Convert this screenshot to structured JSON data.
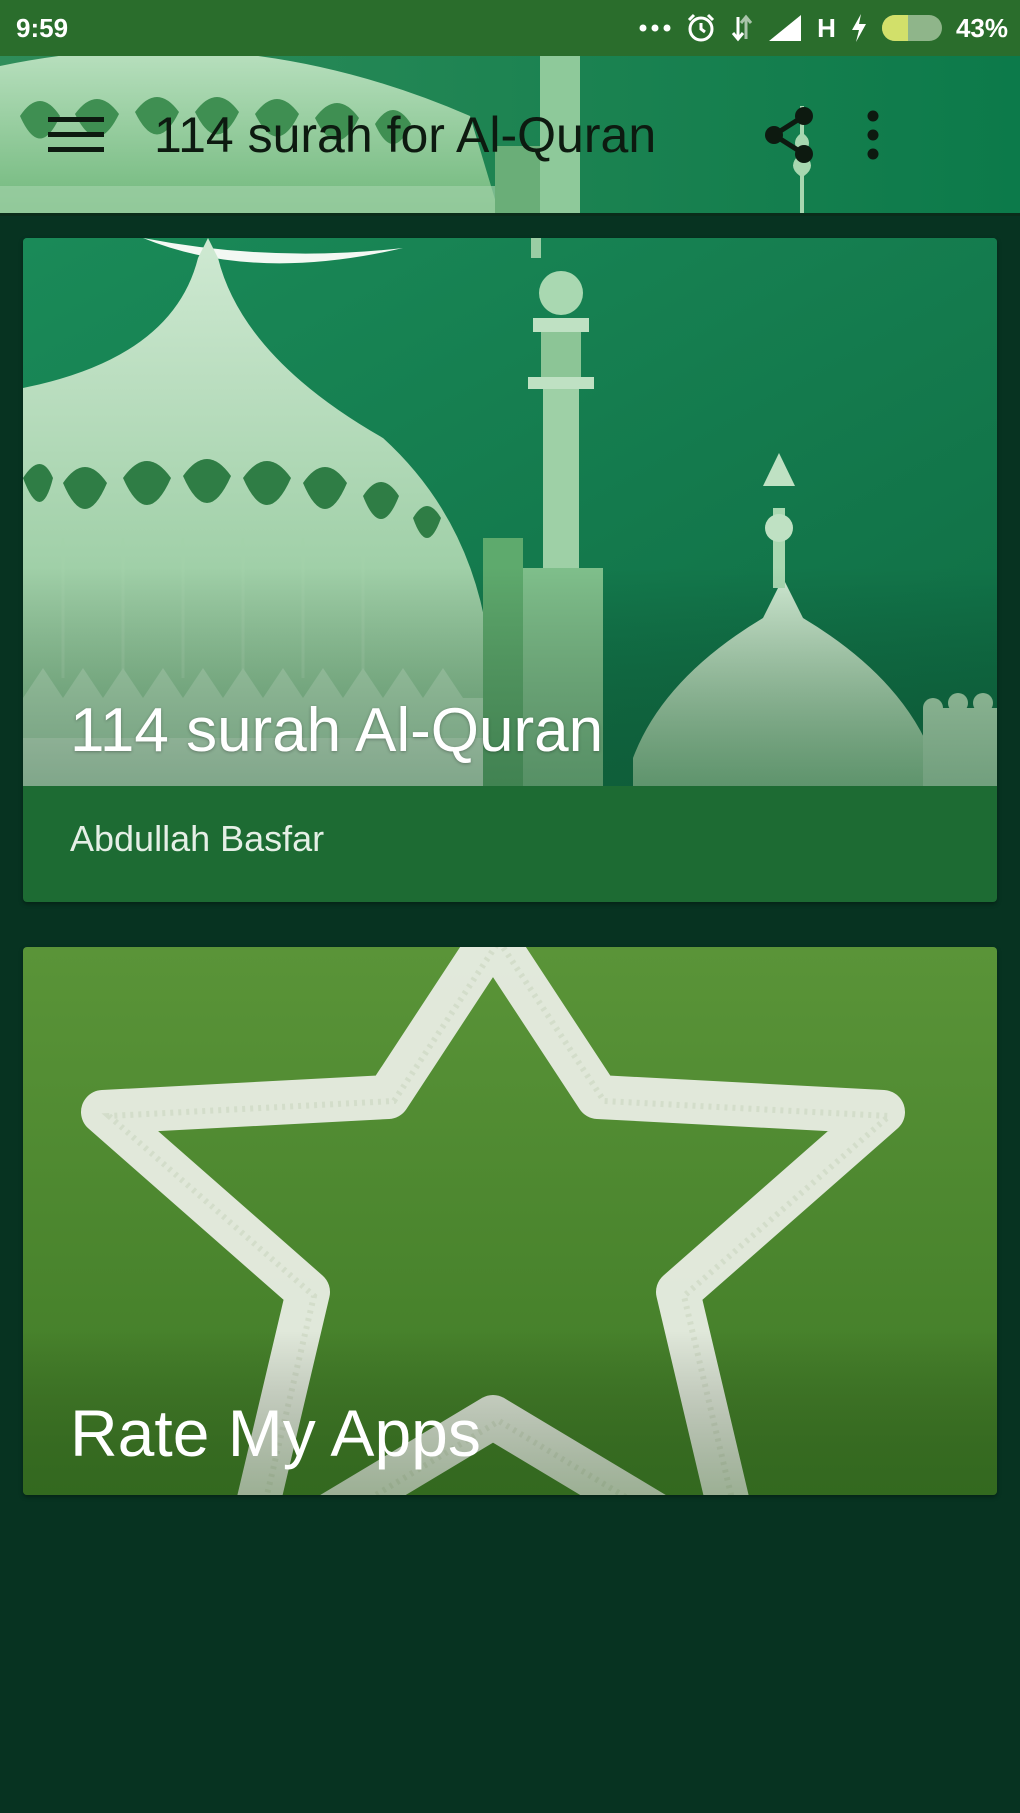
{
  "status_bar": {
    "time": "9:59",
    "network_type": "H",
    "battery_percent": "43%",
    "battery_level": 0.43
  },
  "app_bar": {
    "title": "114 surah for Al-Quran",
    "icons": [
      "menu-icon",
      "share-icon",
      "more-vert-icon"
    ]
  },
  "cards": [
    {
      "title": "114 surah Al-Quran",
      "subtitle": "Abdullah Basfar",
      "image": "mosque-domes"
    },
    {
      "title": "Rate My Apps",
      "image": "chalk-star"
    }
  ],
  "colors": {
    "status_bar": "#2a6d2c",
    "background": "#073321",
    "card_footer": "#1d6b33",
    "card2_green": "#4f8a30"
  }
}
